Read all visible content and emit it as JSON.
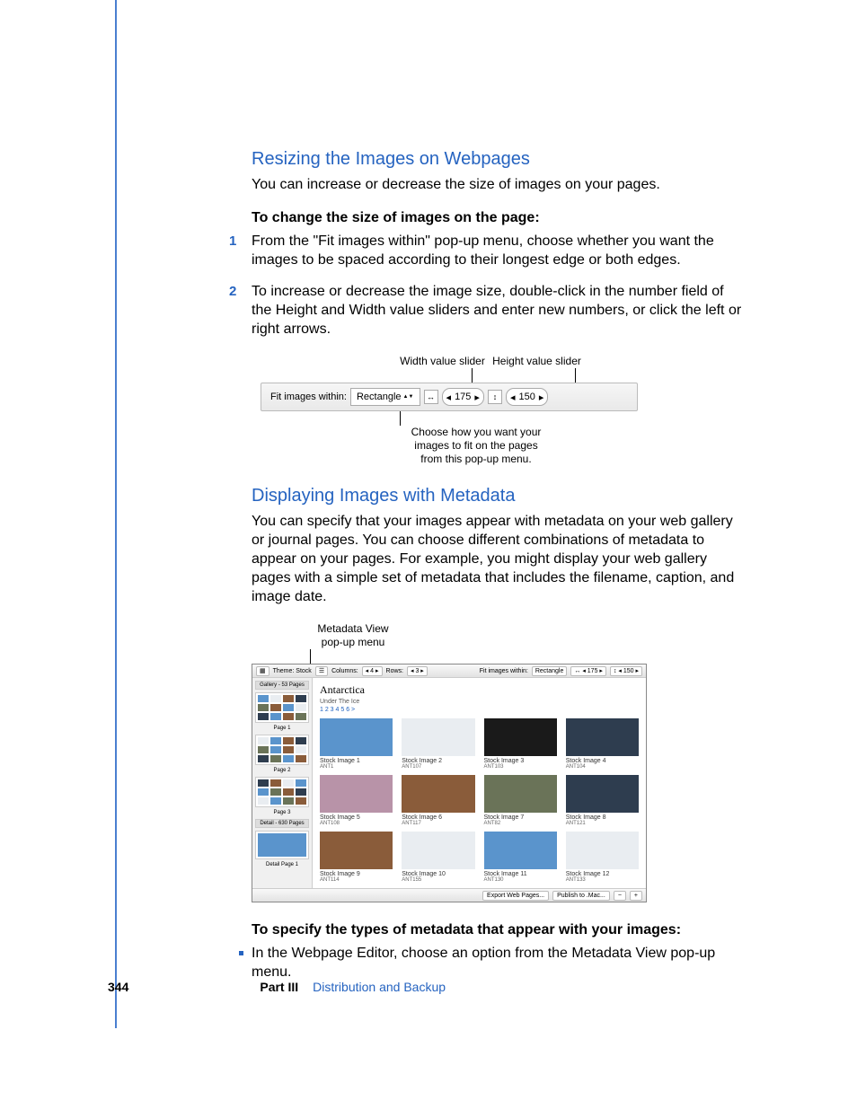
{
  "section1": {
    "heading": "Resizing the Images on Webpages",
    "intro": "You can increase or decrease the size of images on your pages.",
    "task_heading": "To change the size of images on the page:",
    "steps": [
      "From the \"Fit images within\" pop-up menu, choose whether you want the images to be spaced according to their longest edge or both edges.",
      "To increase or decrease the image size, double-click in the number field of the Height and Width value sliders and enter new numbers, or click the left or right arrows."
    ]
  },
  "fig1": {
    "label_width": "Width value slider",
    "label_height": "Height value slider",
    "toolbar_label": "Fit images within:",
    "select_value": "Rectangle",
    "width_value": "175",
    "height_value": "150",
    "caption": "Choose how you want your images to fit on the pages from this pop-up menu."
  },
  "section2": {
    "heading": "Displaying Images with Metadata",
    "body": "You can specify that your images appear with metadata on your web gallery or journal pages. You can choose different combinations of metadata to appear on your pages. For example, you might display your web gallery pages with a simple set of metadata that includes the filename, caption, and image date."
  },
  "fig2": {
    "top_label": "Metadata View pop-up menu",
    "toolbar": {
      "theme_label": "Theme: Stock",
      "columns_label": "Columns:",
      "columns_val": "4",
      "rows_label": "Rows:",
      "rows_val": "3",
      "fit_label": "Fit images within:",
      "fit_select": "Rectangle",
      "w": "175",
      "h": "150"
    },
    "side": {
      "gallery_label": "Gallery - 53 Pages",
      "pages": [
        "Page 1",
        "Page 2",
        "Page 3"
      ],
      "detail_label": "Detail - 630 Pages",
      "detail_page": "Detail Page 1"
    },
    "gallery": {
      "title": "Antarctica",
      "subtitle": "Under The Ice",
      "nav": "1  2  3  4  5  6 >",
      "items": [
        {
          "name": "Stock Image 1",
          "code": "ANT1"
        },
        {
          "name": "Stock Image 2",
          "code": "ANT107"
        },
        {
          "name": "Stock Image 3",
          "code": "ANT103"
        },
        {
          "name": "Stock Image 4",
          "code": "ANT104"
        },
        {
          "name": "Stock Image 5",
          "code": "ANT108"
        },
        {
          "name": "Stock Image 6",
          "code": "ANT117"
        },
        {
          "name": "Stock Image 7",
          "code": "ANT82"
        },
        {
          "name": "Stock Image 8",
          "code": "ANT121"
        },
        {
          "name": "Stock Image 9",
          "code": "ANT114"
        },
        {
          "name": "Stock Image 10",
          "code": "ANT155"
        },
        {
          "name": "Stock Image 11",
          "code": "ANT130"
        },
        {
          "name": "Stock Image 12",
          "code": "ANT133"
        }
      ]
    },
    "footer_buttons": [
      "Export Web Pages...",
      "Publish to .Mac..."
    ]
  },
  "section3": {
    "task_heading": "To specify the types of metadata that appear with your images:",
    "bullet": "In the Webpage Editor, choose an option from the Metadata View pop-up menu."
  },
  "footer": {
    "page_number": "344",
    "part_label": "Part III",
    "part_title": "Distribution and Backup"
  }
}
